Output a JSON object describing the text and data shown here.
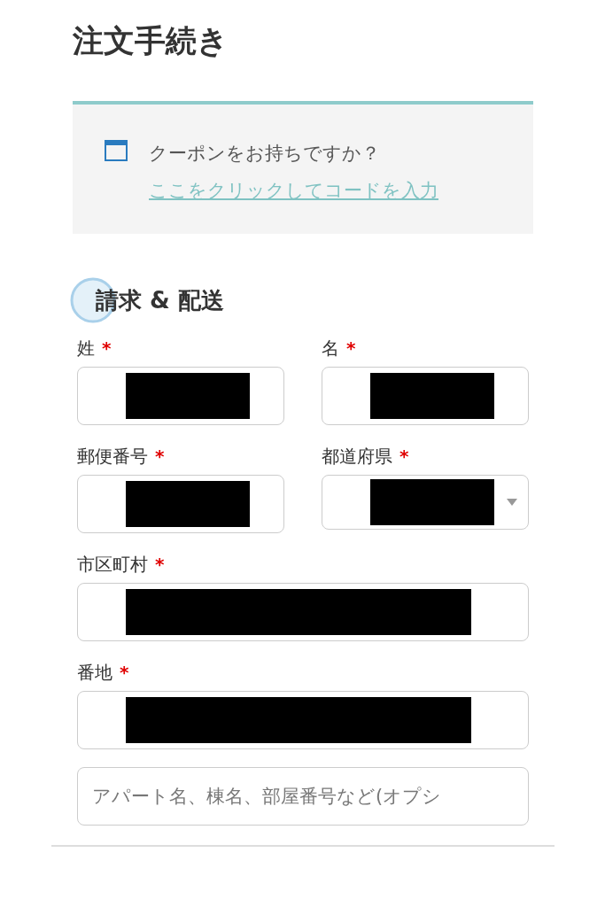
{
  "title": "注文手続き",
  "coupon": {
    "text": "クーポンをお持ちですか？",
    "link": "ここをクリックしてコードを入力"
  },
  "section_title": "請求 & 配送",
  "fields": [
    {
      "label": "姓",
      "required_mark": "*",
      "kind": "text",
      "redacted": true,
      "half": true
    },
    {
      "label": "名",
      "required_mark": "*",
      "kind": "text",
      "redacted": true,
      "half": true
    },
    {
      "label": "郵便番号",
      "required_mark": "*",
      "kind": "text",
      "redacted": true,
      "half": true
    },
    {
      "label": "都道府県",
      "required_mark": "*",
      "kind": "select",
      "redacted": true,
      "half": true
    },
    {
      "label": "市区町村",
      "required_mark": "*",
      "kind": "text",
      "redacted": true,
      "half": false
    },
    {
      "label": "番地",
      "required_mark": "*",
      "kind": "text",
      "redacted": true,
      "half": false
    },
    {
      "kind": "text",
      "redacted": false,
      "half": false,
      "placeholder": "アパート名、棟名、部屋番号など(オプシ"
    }
  ]
}
